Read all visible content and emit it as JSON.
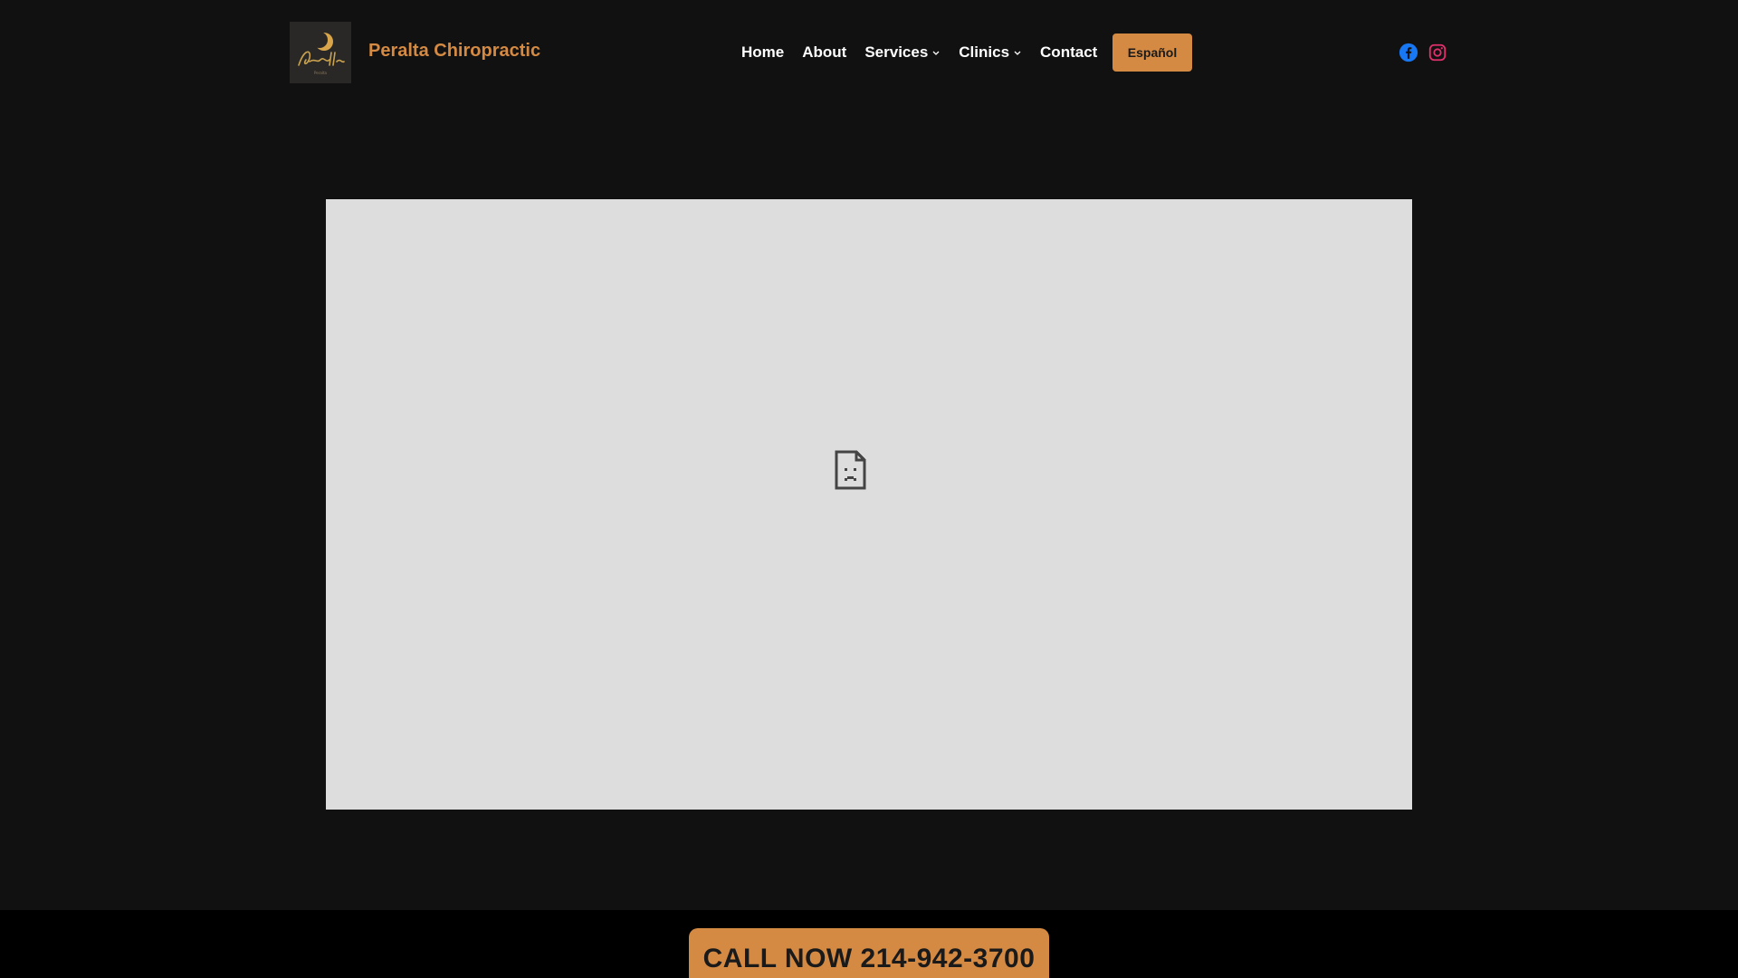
{
  "header": {
    "site_title": "Peralta Chiropractic",
    "logo_text": "Peralta",
    "logo_icon": "crescent-moon-logo",
    "nav": [
      {
        "label": "Home",
        "has_dropdown": false
      },
      {
        "label": "About",
        "has_dropdown": false
      },
      {
        "label": "Services",
        "has_dropdown": true
      },
      {
        "label": "Clinics",
        "has_dropdown": true
      },
      {
        "label": "Contact",
        "has_dropdown": false
      }
    ],
    "language_button": "Español",
    "social": [
      {
        "name": "facebook-icon",
        "color": "#1877f2"
      },
      {
        "name": "instagram-icon",
        "color": "#e1306c"
      }
    ]
  },
  "main": {
    "frame_icon": "sad-page-icon",
    "frame_bg": "#dddddd"
  },
  "footer": {
    "call_button": "CALL NOW 214-942-3700"
  },
  "colors": {
    "accent": "#d48a43",
    "background": "#111111",
    "bottom_bar": "#000000"
  }
}
